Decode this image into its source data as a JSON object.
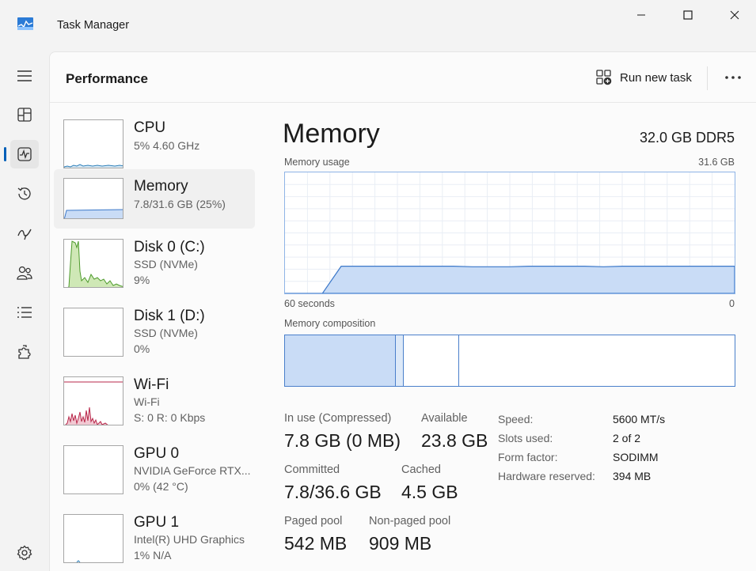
{
  "window": {
    "title": "Task Manager"
  },
  "header": {
    "title": "Performance",
    "run_task_label": "Run new task"
  },
  "rail": [
    "hamburger-menu",
    "processes",
    "performance",
    "app-history",
    "startup-apps",
    "users",
    "details",
    "services",
    "settings"
  ],
  "devices": [
    {
      "name": "CPU",
      "line1": "5% 4.60 GHz",
      "line2": ""
    },
    {
      "name": "Memory",
      "line1": "7.8/31.6 GB (25%)",
      "line2": ""
    },
    {
      "name": "Disk 0 (C:)",
      "line1": "SSD (NVMe)",
      "line2": "9%"
    },
    {
      "name": "Disk 1 (D:)",
      "line1": "SSD (NVMe)",
      "line2": "0%"
    },
    {
      "name": "Wi-Fi",
      "line1": "Wi-Fi",
      "line2": "S: 0 R: 0 Kbps"
    },
    {
      "name": "GPU 0",
      "line1": "NVIDIA GeForce RTX...",
      "line2": "0% (42 °C)"
    },
    {
      "name": "GPU 1",
      "line1": "Intel(R) UHD Graphics",
      "line2": "1% N/A"
    }
  ],
  "memory": {
    "title": "Memory",
    "total": "32.0 GB DDR5",
    "usage_label": "Memory usage",
    "usage_max": "31.6 GB",
    "axis_left": "60 seconds",
    "axis_right": "0",
    "composition_label": "Memory composition",
    "composition_fractions": {
      "in_use": 0.247,
      "modified": 0.018,
      "standby": 0.124
    },
    "usage_history_fraction": [
      0,
      0,
      0,
      0.25,
      0.25,
      0.25,
      0.25,
      0.25,
      0.25,
      0.25,
      0.245,
      0.245,
      0.245,
      0.25,
      0.25,
      0.25,
      0.25,
      0.245,
      0.25,
      0.25,
      0.25,
      0.25,
      0.25,
      0.25,
      0.25
    ],
    "stats": {
      "in_use_label": "In use (Compressed)",
      "in_use": "7.8 GB (0 MB)",
      "available_label": "Available",
      "available": "23.8 GB",
      "committed_label": "Committed",
      "committed": "7.8/36.6 GB",
      "cached_label": "Cached",
      "cached": "4.5 GB",
      "paged_label": "Paged pool",
      "paged": "542 MB",
      "nonpaged_label": "Non-paged pool",
      "nonpaged": "909 MB"
    },
    "specs": [
      {
        "label": "Speed:",
        "value": "5600 MT/s"
      },
      {
        "label": "Slots used:",
        "value": "2 of 2"
      },
      {
        "label": "Form factor:",
        "value": "SODIMM"
      },
      {
        "label": "Hardware reserved:",
        "value": "394 MB"
      }
    ]
  },
  "colors": {
    "accent": "#005fb8",
    "memory_fill": "#c9dcf6",
    "memory_line": "#3b78c9",
    "disk_fill": "#cfe8b6",
    "disk_line": "#4c9a2a",
    "wifi_line": "#b8274a"
  }
}
